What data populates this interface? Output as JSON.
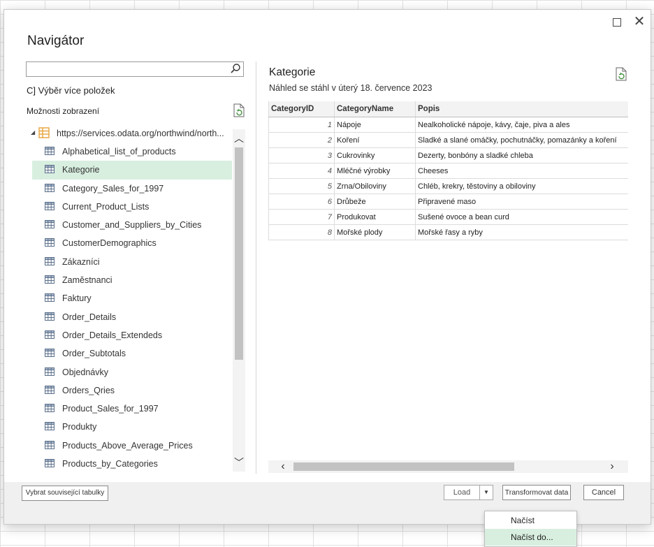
{
  "dialog": {
    "title": "Navigátor",
    "search": {
      "value": "",
      "placeholder": ""
    },
    "select_multiple": "C] Výběr více položek",
    "display_options": "Možnosti zobrazení"
  },
  "tree": {
    "root_url": "https://services.odata.org/northwind/north...",
    "items": [
      {
        "label": "Alphabetical_list_of_products"
      },
      {
        "label": "Kategorie"
      },
      {
        "label": "Category_Sales_for_1997"
      },
      {
        "label": "Current_Product_Lists"
      },
      {
        "label": "Customer_and_Suppliers_by_Cities"
      },
      {
        "label": "CustomerDemographics"
      },
      {
        "label": "Zákazníci"
      },
      {
        "label": "Zaměstnanci"
      },
      {
        "label": "Faktury"
      },
      {
        "label": "Order_Details"
      },
      {
        "label": "Order_Details_Extendeds"
      },
      {
        "label": "Order_Subtotals"
      },
      {
        "label": "Objednávky"
      },
      {
        "label": "Orders_Qries"
      },
      {
        "label": "Product_Sales_for_1997"
      },
      {
        "label": "Produkty"
      },
      {
        "label": "Products_Above_Average_Prices"
      },
      {
        "label": "Products_by_Categories"
      }
    ],
    "selected": "Kategorie"
  },
  "preview": {
    "title": "Kategorie",
    "subtitle": "Náhled se stáhl v úterý 18. července 2023",
    "columns": [
      "CategoryID",
      "CategoryName",
      "Popis"
    ],
    "rows": [
      [
        "1",
        "Nápoje",
        "Nealkoholické nápoje, kávy, čaje, piva a ales"
      ],
      [
        "2",
        "Koření",
        "Sladké a slané omáčky, pochutnáčky, pomazánky a koření"
      ],
      [
        "3",
        "Cukrovinky",
        "Dezerty, bonbóny a sladké chleba"
      ],
      [
        "4",
        " Mléčné výrobky",
        "Cheeses"
      ],
      [
        "5",
        " Zrna/Obiloviny",
        "Chléb, krekry, těstoviny a obiloviny"
      ],
      [
        "6",
        "Drůbeže",
        "Připravené maso"
      ],
      [
        "7",
        "Produkovat",
        "Sušené ovoce a bean curd"
      ],
      [
        "8",
        "Mořské plody",
        "Mořské řasy a ryby"
      ]
    ]
  },
  "footer": {
    "related_tables": "Vybrat související tabulky",
    "load": "Load",
    "transform": "Transformovat data",
    "cancel": "Cancel"
  },
  "load_menu": {
    "items": [
      "Načíst",
      "Načíst do..."
    ],
    "highlighted": "Načíst do..."
  },
  "colors": {
    "selection": "#d8efe0",
    "accent_orange": "#e8a33c",
    "refresh_green": "#3f8f3a"
  }
}
